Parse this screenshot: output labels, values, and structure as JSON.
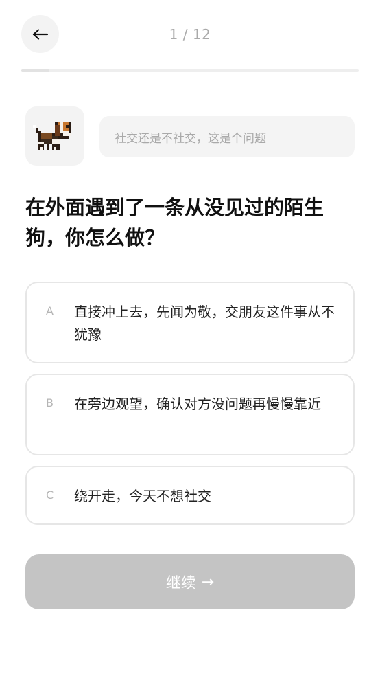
{
  "header": {
    "back_icon": "arrow-left-icon",
    "progress_text": "1 / 12",
    "progress": {
      "current": 1,
      "total": 12
    }
  },
  "prompt": {
    "avatar_icon": "pixel-beagle-dog-icon",
    "bubble_text": "社交还是不社交，这是个问题"
  },
  "question": {
    "text": "在外面遇到了一条从没见过的陌生狗，你怎么做？"
  },
  "options": [
    {
      "letter": "A",
      "text": "直接冲上去，先闻为敬，交朋友这件事从不犹豫"
    },
    {
      "letter": "B",
      "text": "在旁边观望，确认对方没问题再慢慢靠近"
    },
    {
      "letter": "C",
      "text": "绕开走，今天不想社交"
    }
  ],
  "footer": {
    "continue_label": "继续",
    "continue_arrow": "→",
    "continue_state": "disabled"
  },
  "colors": {
    "button_disabled": "#c4c4c4",
    "option_border": "#e6e6e6",
    "muted_text": "#aaaaaa"
  }
}
